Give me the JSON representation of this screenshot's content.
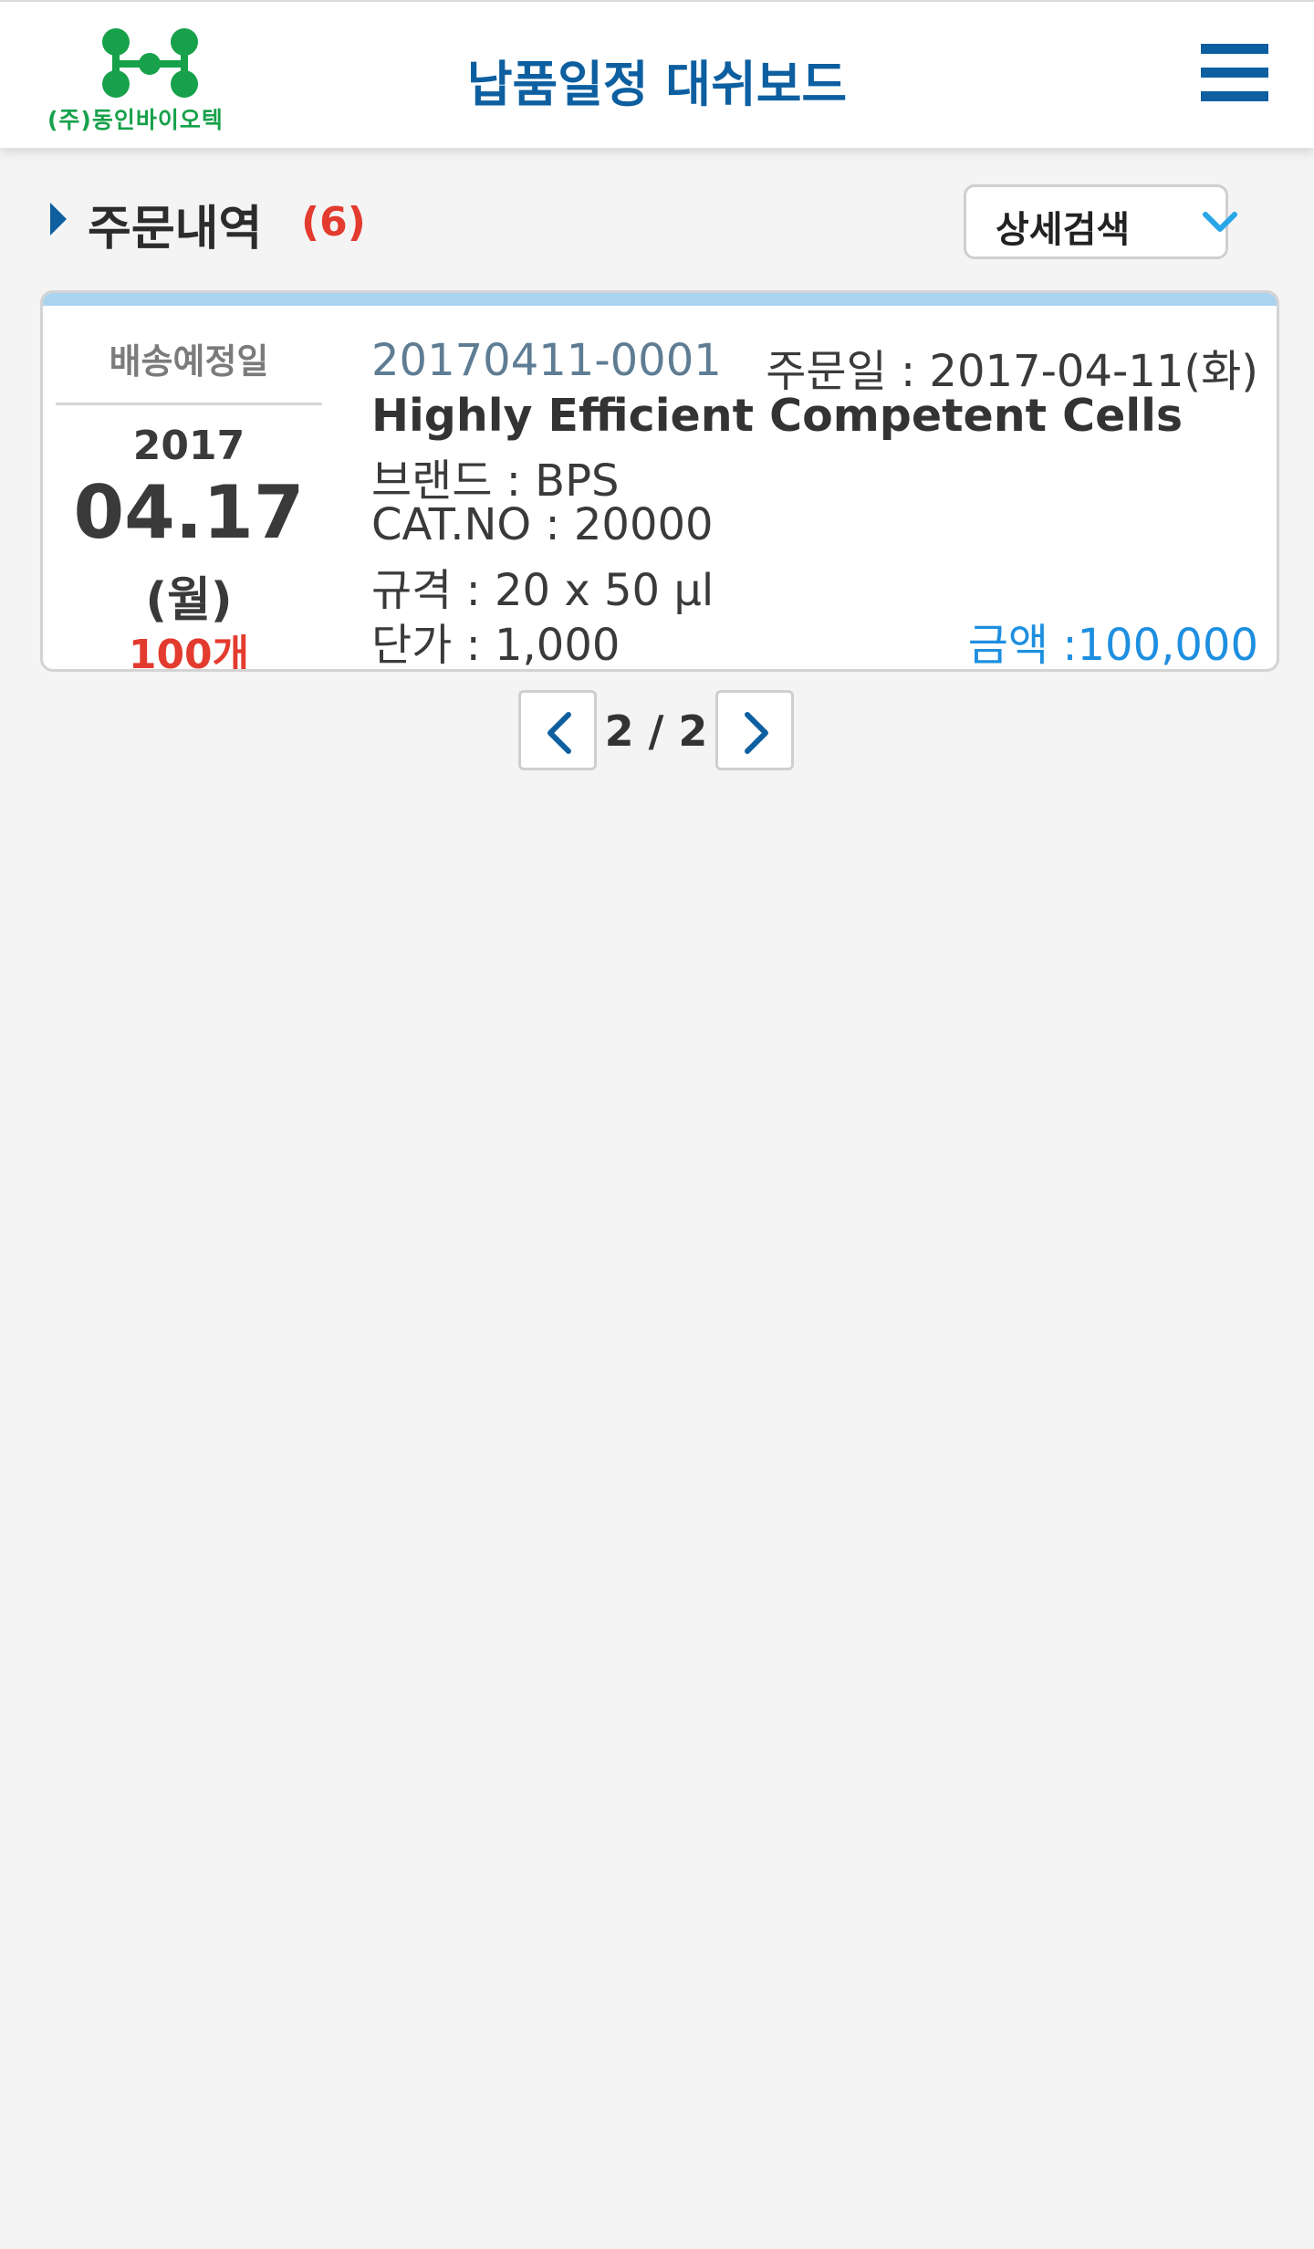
{
  "header": {
    "logo_text": "(주)동인바이오텍",
    "title": "납품일정 대쉬보드"
  },
  "section": {
    "title": "주문내역",
    "count": "(6)"
  },
  "detail_search": {
    "label": "상세검색"
  },
  "order": {
    "delivery_label": "배송예정일",
    "year": "2017",
    "month_day": "04.17",
    "weekday": "(월)",
    "quantity": "100개",
    "order_no": "20170411-0001",
    "order_date": "주문일 : 2017-04-11(화)",
    "product": "Highly Efficient Competent Cells",
    "brand": "브랜드 : BPS",
    "cat_no": "CAT.NO : 20000",
    "spec": "규격 : 20 x 50 μl",
    "unit_price": "단가 : 1,000",
    "amount": "금액 :100,000"
  },
  "pager": {
    "text": "2 / 2"
  },
  "colors": {
    "brand_blue": "#0d5fa0",
    "logo_green": "#16a14a",
    "accent_red": "#e33b2e",
    "amount_blue": "#1e8fe0"
  }
}
